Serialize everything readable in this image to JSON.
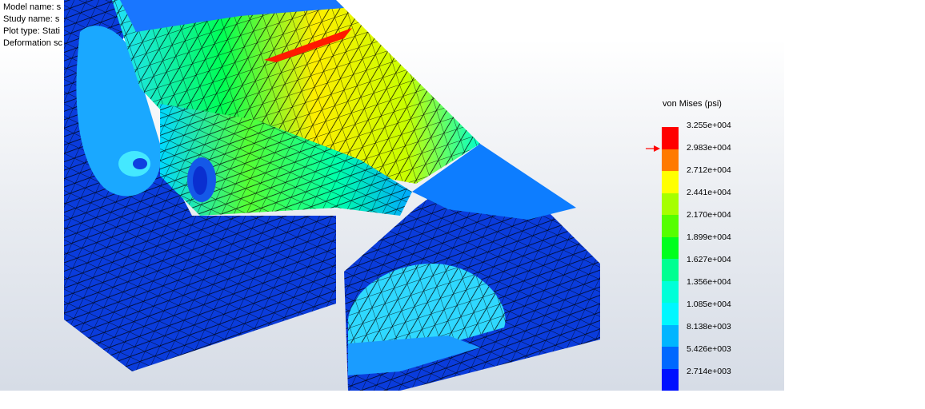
{
  "info": {
    "model_name_label": "Model name: ",
    "model_name_value": "s",
    "study_name_label": "Study name: ",
    "study_name_value": "s",
    "plot_type_label": "Plot type: ",
    "plot_type_value": "Stati",
    "deformation_label": "Deformation sc"
  },
  "legend": {
    "title": "von Mises (psi)",
    "values": [
      "3.255e+004",
      "2.983e+004",
      "2.712e+004",
      "2.441e+004",
      "2.170e+004",
      "1.899e+004",
      "1.627e+004",
      "1.356e+004",
      "1.085e+004",
      "8.138e+003",
      "5.426e+003",
      "2.714e+003"
    ],
    "colors": [
      "#ff0000",
      "#ff7a00",
      "#ffff00",
      "#a6ff00",
      "#55ff00",
      "#00ff1e",
      "#00ff91",
      "#00ffd8",
      "#00f7ff",
      "#00b5ff",
      "#0068ff",
      "#0010ff"
    ],
    "marker_color": "#ff0000"
  }
}
